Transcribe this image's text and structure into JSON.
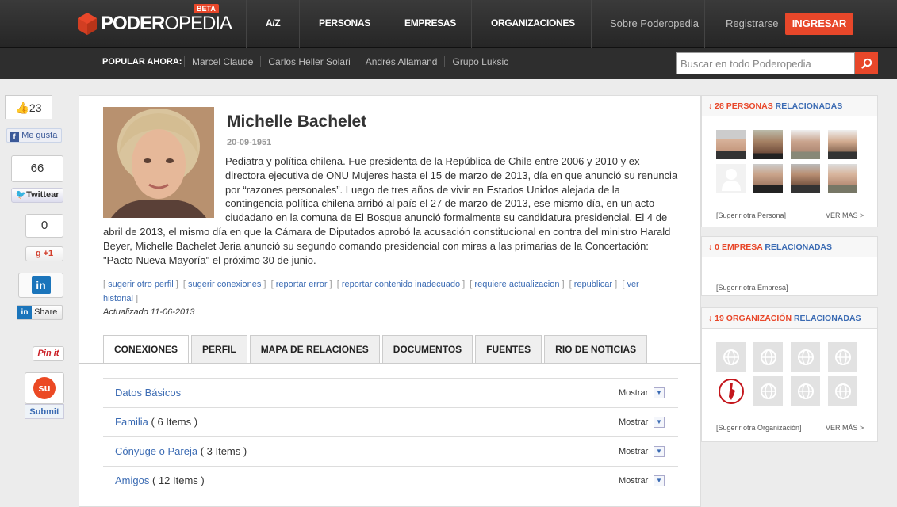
{
  "header": {
    "logo_bold": "PODER",
    "logo_thin": "OPEDIA",
    "beta": "BETA",
    "nav": [
      "A/Z",
      "PERSONAS",
      "EMPRESAS",
      "ORGANIZACIONES"
    ],
    "links": [
      "Sobre Poderopedia",
      "Registrarse"
    ],
    "login": "INGRESAR"
  },
  "subbar": {
    "popular_label": "POPULAR AHORA:",
    "popular": [
      "Marcel Claude",
      "Carlos Heller Solari",
      "Andrés Allamand",
      "Grupo Luksic"
    ],
    "search_placeholder": "Buscar en todo Poderopedia"
  },
  "social": {
    "likes": "23",
    "like_label": "Me gusta",
    "tweets": "66",
    "tweet_label": "Twittear",
    "plus": "0",
    "plus_label": "+1",
    "share_label": "Share",
    "pin_label": "Pin it",
    "submit_label": "Submit"
  },
  "profile": {
    "name": "Michelle Bachelet",
    "dob": "20-09-1951",
    "bio": "Pediatra y política chilena. Fue presidenta de la República de Chile entre 2006 y 2010 y ex directora ejecutiva de ONU Mujeres hasta el 15 de marzo de 2013, día en que anunció su renuncia por “razones personales”. Luego de tres años de vivir en Estados Unidos alejada de la contingencia política chilena arribó al país el 27 de marzo de 2013, ese mismo día, en un acto ciudadano en la comuna de El Bosque anunció formalmente su candidatura presidencial. El 4 de abril de 2013, el mismo día en que la Cámara de Diputados aprobó la acusación constitucional en contra del ministro Harald Beyer, Michelle Bachelet Jeria anunció su segundo comando presidencial con miras a las primarias de la Concertación: \"Pacto Nueva Mayoría\" el próximo 30 de junio.",
    "actions": [
      "sugerir otro perfil",
      "sugerir conexiones",
      "reportar error",
      "reportar contenido inadecuado",
      "requiere actualizacion",
      "republicar",
      "ver historial"
    ],
    "updated": "Actualizado 11-06-2013"
  },
  "tabs": [
    "CONEXIONES",
    "PERFIL",
    "MAPA DE RELACIONES",
    "DOCUMENTOS",
    "FUENTES",
    "RIO DE NOTICIAS"
  ],
  "rows": [
    {
      "label": "Datos Básicos",
      "count": "",
      "action": "Mostrar"
    },
    {
      "label": "Familia",
      "count": " ( 6 Items )",
      "action": "Mostrar"
    },
    {
      "label": "Cónyuge o Pareja",
      "count": " ( 3 Items )",
      "action": "Mostrar"
    },
    {
      "label": "Amigos",
      "count": " ( 12 Items )",
      "action": "Mostrar"
    }
  ],
  "side": {
    "personas": {
      "arrow": "↓",
      "num": "28",
      "type": "PERSONAS",
      "rel": "RELACIONADAS",
      "suggest": "[Sugerir otra Persona]",
      "more": "VER MÁS >"
    },
    "empresa": {
      "arrow": "↓",
      "num": "0",
      "type": "EMPRESA",
      "rel": "RELACIONADAS",
      "suggest": "[Sugerir otra Empresa]"
    },
    "org": {
      "arrow": "↓",
      "num": "19",
      "type": "ORGANIZACIÓN",
      "rel": "RELACIONADAS",
      "suggest": "[Sugerir otra Organización]",
      "more": "VER MÁS >"
    }
  },
  "colors": {
    "accent": "#e8472a",
    "link": "#3b6bb3"
  }
}
